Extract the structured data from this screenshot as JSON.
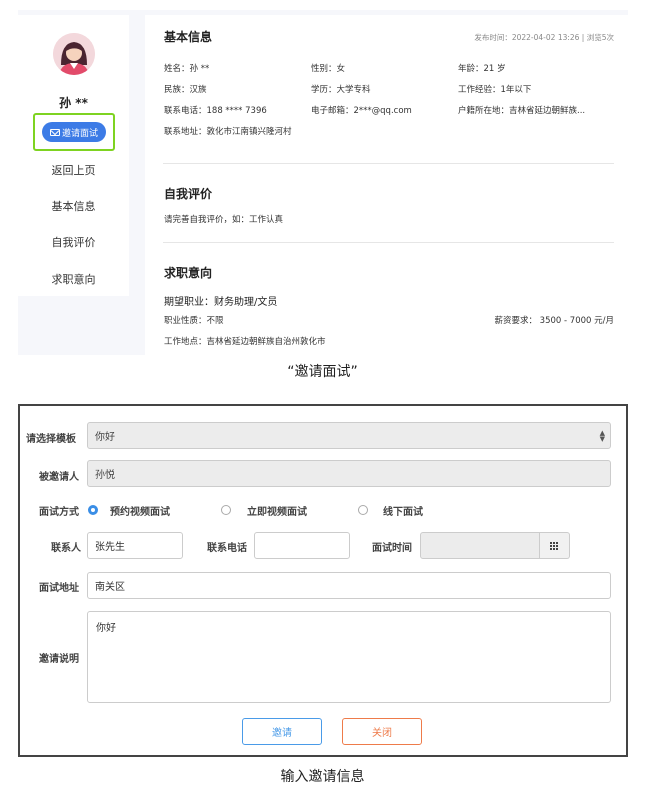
{
  "profile": {
    "name": "孙 **",
    "invite_label": "邀请面试",
    "nav": [
      "返回上页",
      "基本信息",
      "自我评价",
      "求职意向"
    ]
  },
  "basic": {
    "title": "基本信息",
    "meta": "发布时间：2022-04-02 13:26 | 浏览5次",
    "name": "姓名：孙 **",
    "gender": "性别：女",
    "age": "年龄：21 岁",
    "ethnicity": "民族：汉族",
    "education": "学历：大学专科",
    "experience": "工作经验：1年以下",
    "phone": "联系电话：188 **** 7396",
    "email": "电子邮箱：2***@qq.com",
    "hukou": "户籍所在地：吉林省延边朝鲜族...",
    "address": "联系地址：敦化市江南镇兴隆河村"
  },
  "self_eval": {
    "title": "自我评价",
    "text": "请完善自我评价，如：工作认真"
  },
  "intention": {
    "title": "求职意向",
    "job": "期望职业：财务助理/文员",
    "nature": "职业性质：不限",
    "salary": "薪资要求： 3500 - 7000 元/月",
    "location": "工作地点：吉林省延边朝鲜族自治州敦化市"
  },
  "caption_top": "“邀请面试”",
  "form": {
    "template_label": "请选择模板",
    "template_value": "你好",
    "invitee_label": "被邀请人",
    "invitee_value": "孙悦",
    "method_label": "面试方式",
    "methods": [
      "预约视频面试",
      "立即视频面试",
      "线下面试"
    ],
    "selected_method": "预约视频面试",
    "contact_label": "联系人",
    "contact_value": "张先生",
    "phone_label": "联系电话",
    "phone_value": "",
    "time_label": "面试时间",
    "time_value": "",
    "address_label": "面试地址",
    "address_value": "南关区",
    "note_label": "邀请说明",
    "note_value": "你好",
    "invite_button": "邀请",
    "close_button": "关闭"
  },
  "caption_bottom": "输入邀请信息",
  "colors": {
    "accent_blue": "#3c7be6",
    "highlight_green": "#7ed321",
    "close_orange": "#ee7b4a"
  },
  "icons": [
    "avatar-icon",
    "envelope-icon",
    "caret-updown-icon",
    "calendar-grid-icon"
  ]
}
